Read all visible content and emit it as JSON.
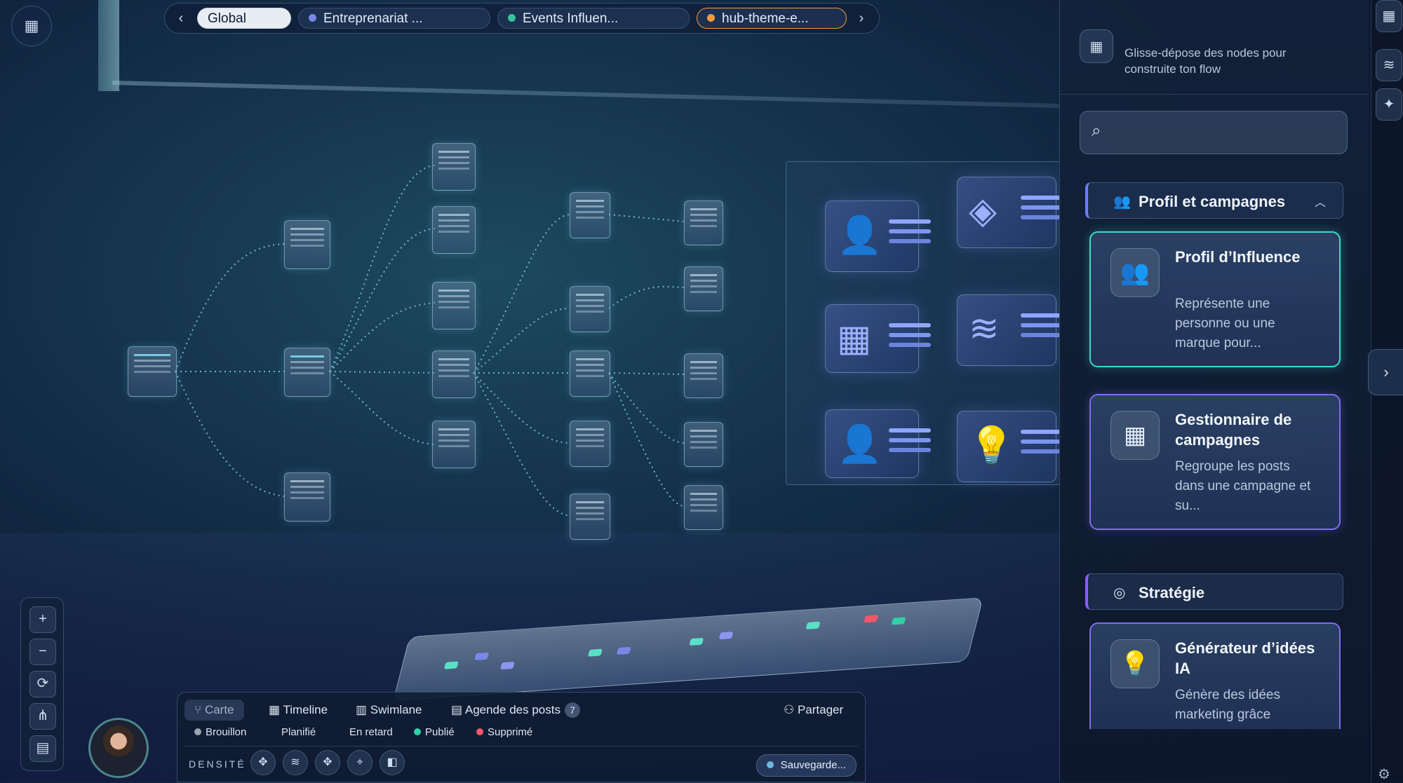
{
  "tabs": {
    "items": [
      {
        "label": "Global",
        "color": ""
      },
      {
        "label": "Entreprenariat ...",
        "color": "#7a86e8"
      },
      {
        "label": "Events Influen...",
        "color": "#34c59b"
      },
      {
        "label": "hub-theme-e...",
        "color": "#f39a3c"
      }
    ],
    "prev_icon": "chevron-left-icon",
    "next_icon": "chevron-right-icon"
  },
  "panel": {
    "hint": "Glisse-dépose des nodes pour construite ton flow",
    "search_placeholder": "",
    "sections": [
      {
        "label": "Profil et campagnes",
        "icon": "users-icon",
        "expanded": true,
        "accent": "#6a7dff"
      },
      {
        "label": "Stratégie",
        "icon": "brain-icon",
        "accent": "#8a5cff"
      }
    ],
    "cards": [
      {
        "title": "Profil d’Influence",
        "desc": "Représente une personne ou une marque pour...",
        "icon": "users-icon",
        "border": "#3fd8c4"
      },
      {
        "title": "Gestionnaire de campagnes",
        "desc": "Regroupe les posts dans une campagne et su...",
        "icon": "grid-icon",
        "border": "#7d6cf0"
      },
      {
        "title": "Générateur d’idées IA",
        "desc": "Génère des idées marketing grâce",
        "icon": "lightbulb-icon",
        "border": "#7d6cf0"
      }
    ]
  },
  "dock": {
    "views": [
      {
        "label": "Carte",
        "icon": "branch-icon",
        "active": true
      },
      {
        "label": "Timeline",
        "icon": "calendar-icon"
      },
      {
        "label": "Swimlane",
        "icon": "columns-icon"
      },
      {
        "label": "Agende des posts",
        "icon": "agenda-icon",
        "badge": "7"
      }
    ],
    "share_label": "Partager",
    "legend": [
      {
        "label": "Brouillon",
        "color": "#9aa4b2"
      },
      {
        "label": "Planifié",
        "color": ""
      },
      {
        "label": "En retard",
        "color": ""
      },
      {
        "label": "Publié",
        "color": "#2fd3a5"
      },
      {
        "label": "Supprimé",
        "color": "#f0596a"
      }
    ],
    "density_label": "DENSITÉ",
    "save_label": "Sauvegarde..."
  }
}
